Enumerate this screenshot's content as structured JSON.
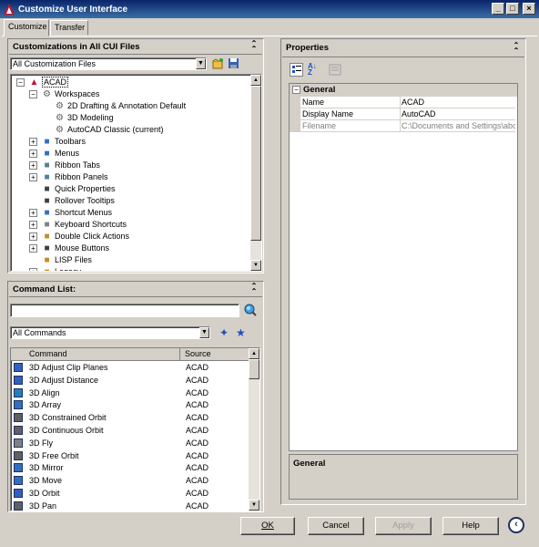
{
  "window": {
    "title": "Customize User Interface",
    "min": "_",
    "max": "□",
    "close": "×"
  },
  "tabs": [
    {
      "label": "Customize"
    },
    {
      "label": "Transfer"
    }
  ],
  "customizations": {
    "title": "Customizations in All CUI Files",
    "filter": "All Customization Files",
    "tree": [
      {
        "label": "ACAD",
        "level": 0,
        "expander": "−",
        "icon": "acad-icon"
      },
      {
        "label": "Workspaces",
        "level": 1,
        "expander": "−",
        "icon": "gear-icon"
      },
      {
        "label": "2D Drafting & Annotation Default",
        "level": 2,
        "expander": "",
        "icon": "gear-icon"
      },
      {
        "label": "3D Modeling",
        "level": 2,
        "expander": "",
        "icon": "gear-icon"
      },
      {
        "label": "AutoCAD Classic (current)",
        "level": 2,
        "expander": "",
        "icon": "gear-icon"
      },
      {
        "label": "Toolbars",
        "level": 1,
        "expander": "+",
        "icon": "toolbar-icon"
      },
      {
        "label": "Menus",
        "level": 1,
        "expander": "+",
        "icon": "menu-icon"
      },
      {
        "label": "Ribbon Tabs",
        "level": 1,
        "expander": "+",
        "icon": "ribbon-tab-icon"
      },
      {
        "label": "Ribbon Panels",
        "level": 1,
        "expander": "+",
        "icon": "ribbon-panel-icon"
      },
      {
        "label": "Quick Properties",
        "level": 1,
        "expander": "",
        "icon": "quick-properties-icon"
      },
      {
        "label": "Rollover Tooltips",
        "level": 1,
        "expander": "",
        "icon": "tooltip-icon"
      },
      {
        "label": "Shortcut Menus",
        "level": 1,
        "expander": "+",
        "icon": "shortcut-menu-icon"
      },
      {
        "label": "Keyboard Shortcuts",
        "level": 1,
        "expander": "+",
        "icon": "keyboard-icon"
      },
      {
        "label": "Double Click Actions",
        "level": 1,
        "expander": "+",
        "icon": "double-click-icon"
      },
      {
        "label": "Mouse Buttons",
        "level": 1,
        "expander": "+",
        "icon": "mouse-icon"
      },
      {
        "label": "LISP Files",
        "level": 1,
        "expander": "",
        "icon": "lisp-icon"
      },
      {
        "label": "Legacy",
        "level": 1,
        "expander": "+",
        "icon": "legacy-icon"
      }
    ]
  },
  "command_list": {
    "title": "Command List:",
    "search_value": "",
    "filter": "All Commands",
    "columns": {
      "command": "Command",
      "source": "Source"
    },
    "rows": [
      {
        "name": "3D Adjust Clip Planes",
        "source": "ACAD"
      },
      {
        "name": "3D Adjust Distance",
        "source": "ACAD"
      },
      {
        "name": "3D Align",
        "source": "ACAD"
      },
      {
        "name": "3D Array",
        "source": "ACAD"
      },
      {
        "name": "3D Constrained Orbit",
        "source": "ACAD"
      },
      {
        "name": "3D Continuous Orbit",
        "source": "ACAD"
      },
      {
        "name": "3D Fly",
        "source": "ACAD"
      },
      {
        "name": "3D Free Orbit",
        "source": "ACAD"
      },
      {
        "name": "3D Mirror",
        "source": "ACAD"
      },
      {
        "name": "3D Move",
        "source": "ACAD"
      },
      {
        "name": "3D Orbit",
        "source": "ACAD"
      },
      {
        "name": "3D Pan",
        "source": "ACAD"
      }
    ]
  },
  "properties": {
    "title": "Properties",
    "category": "General",
    "rows": [
      {
        "name": "Name",
        "value": "ACAD"
      },
      {
        "name": "Display Name",
        "value": "AutoCAD"
      },
      {
        "name": "Filename",
        "value": "C:\\Documents and Settings\\aboz"
      }
    ],
    "description_title": "General"
  },
  "buttons": {
    "ok": "OK",
    "cancel": "Cancel",
    "apply": "Apply",
    "help": "Help"
  },
  "colors": {
    "title_start": "#0a246a",
    "title_end": "#3a6ea5",
    "acad_red": "#c8102e"
  }
}
